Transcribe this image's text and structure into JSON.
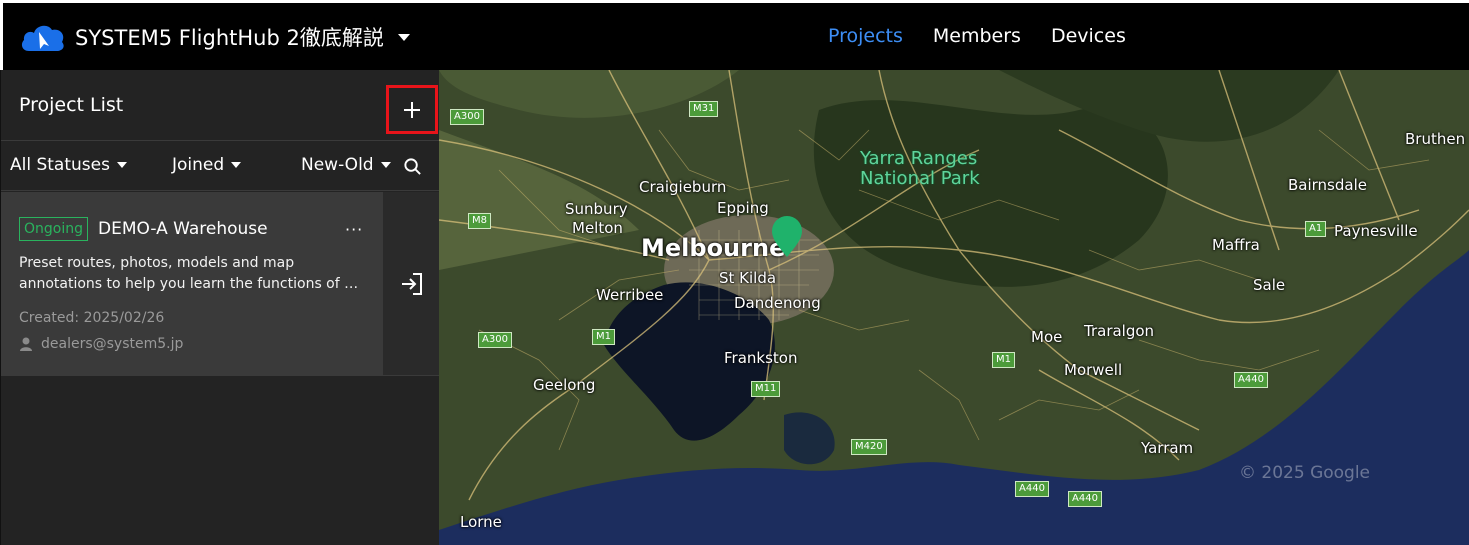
{
  "header": {
    "app_title": "SYSTEM5 FlightHub 2徹底解説",
    "nav": [
      {
        "label": "Projects",
        "active": true
      },
      {
        "label": "Members",
        "active": false
      },
      {
        "label": "Devices",
        "active": false
      }
    ]
  },
  "sidebar": {
    "title": "Project List",
    "filters": {
      "status": "All Statuses",
      "membership": "Joined",
      "sort": "New-Old"
    },
    "projects": [
      {
        "status": "Ongoing",
        "name": "DEMO-A Warehouse",
        "more": "···",
        "description_line1": "Preset routes, photos, models and map",
        "description_line2": "annotations to help you learn the functions of D...",
        "created": "Created: 2025/02/26",
        "owner": "dealers@system5.jp"
      }
    ]
  },
  "map": {
    "places": {
      "melbourne": "Melbourne",
      "yarra_line1": "Yarra Ranges",
      "yarra_line2": "National Park",
      "sunbury": "Sunbury",
      "craigieburn": "Craigieburn",
      "melton": "Melton",
      "epping": "Epping",
      "st_kilda": "St Kilda",
      "werribee": "Werribee",
      "dandenong": "Dandenong",
      "frankston": "Frankston",
      "geelong": "Geelong",
      "moe": "Moe",
      "traralgon": "Traralgon",
      "morwell": "Morwell",
      "maffra": "Maffra",
      "sale": "Sale",
      "bairnsdale": "Bairnsdale",
      "bruthen": "Bruthen",
      "paynesville": "Paynesville",
      "yarram": "Yarram",
      "lorne": "Lorne"
    },
    "roads": {
      "a300_top": "A300",
      "m31": "M31",
      "m8": "M8",
      "m1_west": "M1",
      "a300_west": "A300",
      "m11": "M11",
      "m420": "M420",
      "m1_east": "M1",
      "a1": "A1",
      "a440_1": "A440",
      "a440_2": "A440",
      "a440_3": "A440"
    },
    "watermark": "© 2025 Google",
    "colors": {
      "land": "#3c4a2c",
      "water": "#1c2d5e",
      "bay": "#0d1526",
      "pin": "#1fb26b"
    }
  }
}
